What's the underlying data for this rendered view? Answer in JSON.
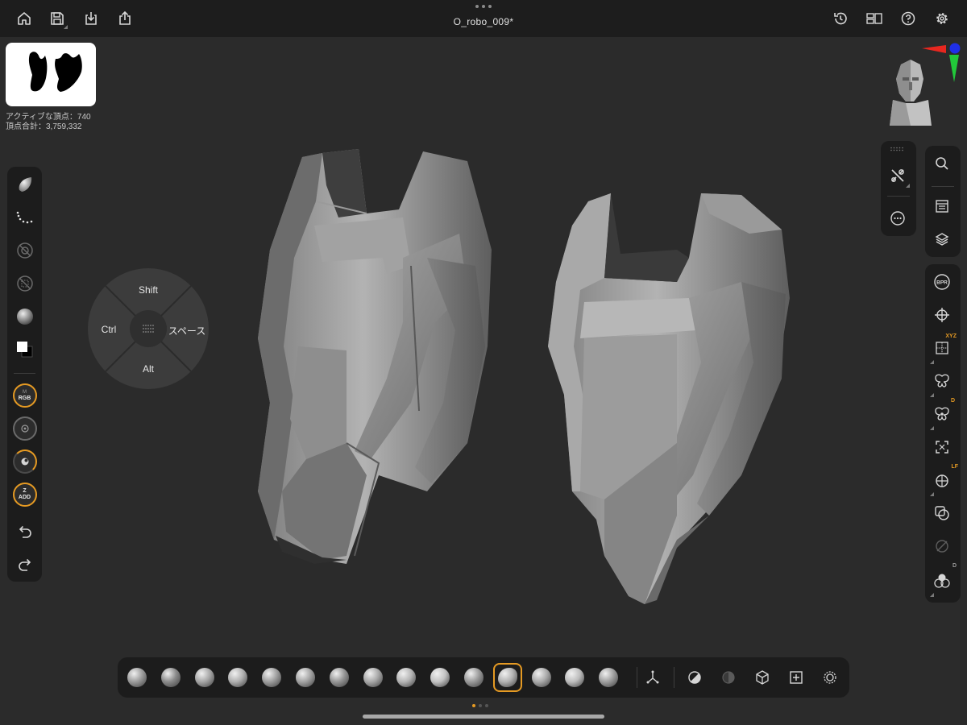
{
  "app": {
    "document_title": "O_robo_009*"
  },
  "header": {
    "left_buttons": [
      {
        "icon": "home-icon"
      },
      {
        "icon": "save-icon"
      },
      {
        "icon": "import-icon"
      },
      {
        "icon": "share-icon"
      }
    ],
    "right_buttons": [
      {
        "icon": "history-icon"
      },
      {
        "icon": "layout-icon"
      },
      {
        "icon": "help-icon"
      },
      {
        "icon": "settings-icon"
      }
    ]
  },
  "stats": {
    "active_vertices": "アクティブな頂点：740",
    "total_vertices": "頂点合計：3,759,332"
  },
  "left_toolbar": {
    "items": [
      {
        "icon": "brush-icon"
      },
      {
        "icon": "stroke-dots-icon"
      },
      {
        "icon": "alpha-off-icon"
      },
      {
        "icon": "texture-off-icon"
      },
      {
        "icon": "material-sphere-icon"
      },
      {
        "icon": "color-swatch-icon"
      },
      {
        "icon": "rgb-mode-icon",
        "label": "RGB",
        "sup": "M"
      },
      {
        "icon": "draw-size-icon"
      },
      {
        "icon": "intensity-icon"
      },
      {
        "icon": "zadd-icon",
        "label": "ADD",
        "sup": "Z"
      },
      {
        "icon": "undo-icon"
      },
      {
        "icon": "redo-icon"
      }
    ]
  },
  "modifier_pie": {
    "top": "Shift",
    "left": "Ctrl",
    "right": "スペース",
    "bottom": "Alt"
  },
  "right_toolbar": {
    "tools_tray": [
      {
        "icon": "grip-icon"
      },
      {
        "icon": "tools-icon"
      },
      {
        "icon": "more-icon"
      }
    ],
    "panel_tray": [
      {
        "icon": "search-icon"
      },
      {
        "icon": "subtool-list-icon"
      },
      {
        "icon": "layers-icon"
      }
    ],
    "view_tray": [
      {
        "icon": "bpr-icon",
        "label": "BPR"
      },
      {
        "icon": "move-view-icon"
      },
      {
        "icon": "floor-grid-icon",
        "badge": "XYZ"
      },
      {
        "icon": "symmetry-icon"
      },
      {
        "icon": "dynamic-symmetry-icon",
        "badge": "D"
      },
      {
        "icon": "frame-icon"
      },
      {
        "icon": "local-perspective-icon",
        "badge": "LF"
      },
      {
        "icon": "transparency-icon"
      },
      {
        "icon": "ghost-icon"
      },
      {
        "icon": "dynamic-polyframe-icon",
        "badge": "D"
      }
    ]
  },
  "bottom_palette": {
    "brushes": [
      {
        "icon": "brush-claybuildup-icon",
        "color": "#9c9c9c"
      },
      {
        "icon": "brush-clay-icon",
        "color": "#8a8a8a"
      },
      {
        "icon": "brush-dam-standard-icon",
        "color": "#a6a6a6"
      },
      {
        "icon": "brush-move-icon",
        "color": "#b0b0b0"
      },
      {
        "icon": "brush-inflate-icon",
        "color": "#9e9e9e"
      },
      {
        "icon": "brush-pinch-icon",
        "color": "#a3a3a3"
      },
      {
        "icon": "brush-smooth-icon",
        "color": "#959595"
      },
      {
        "icon": "brush-trim-dynamic-icon",
        "color": "#a8a8a8"
      },
      {
        "icon": "brush-hpolish-icon",
        "color": "#b5b5b5"
      },
      {
        "icon": "brush-standard-icon",
        "color": "#c2c2c2"
      },
      {
        "icon": "brush-imm-curve-icon",
        "color": "#9a9a9a"
      },
      {
        "icon": "brush-active-claytubes-icon",
        "color": "#b3b3b3"
      },
      {
        "icon": "brush-orb-icon",
        "color": "#aaaaaa"
      },
      {
        "icon": "brush-slash-icon",
        "color": "#bdbdbd"
      },
      {
        "icon": "brush-snakehook-icon",
        "color": "#9f9f9f"
      }
    ],
    "active_index": 11,
    "utilities": [
      {
        "icon": "gizmo-icon"
      },
      {
        "icon": "solo-icon"
      },
      {
        "icon": "transp-icon"
      },
      {
        "icon": "polyframe-icon"
      },
      {
        "icon": "draw-icon"
      },
      {
        "icon": "xpose-icon"
      }
    ],
    "page_count": 3,
    "current_page": 1
  },
  "colors": {
    "accent": "#e59a23",
    "background": "#2b2b2b",
    "panel": "#1c1c1c"
  }
}
